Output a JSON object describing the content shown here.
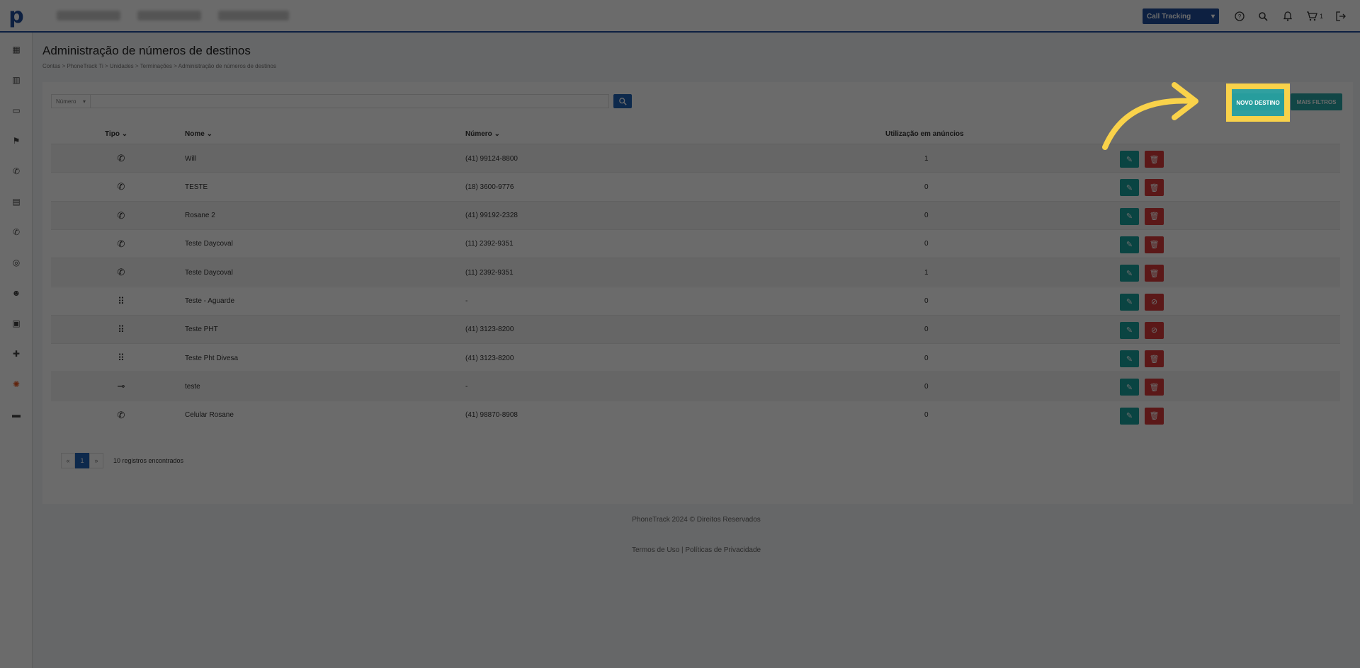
{
  "topbar": {
    "logo_letter": "p",
    "product_select": "Call Tracking",
    "cart_count": "1",
    "icons": [
      "help-icon",
      "search-icon",
      "bell-icon",
      "cart-icon",
      "logout-icon"
    ]
  },
  "sidebar": {
    "icons": [
      "dashboard-icon",
      "buildings-icon",
      "briefcase-icon",
      "flag-icon",
      "phone-icon",
      "contact-card-icon",
      "phone-in-icon",
      "circle-icon",
      "users-icon",
      "library-icon",
      "puzzle-icon",
      "settings-icon",
      "store-icon"
    ]
  },
  "page": {
    "title": "Administração de números de destinos",
    "breadcrumb": "Contas  >  PhoneTrack Ti  >  Unidades  >  Terminações  >  Administração de números de destinos"
  },
  "search": {
    "field_label": "Número",
    "placeholder": ""
  },
  "buttons": {
    "novo_destino": "NOVO DESTINO",
    "mais_filtros": "MAIS FILTROS"
  },
  "table": {
    "headers": {
      "tipo": "Tipo",
      "nome": "Nome",
      "numero": "Número",
      "utilizacao": "Utilização em anúncios"
    },
    "rows": [
      {
        "type_icon": "phone-icon",
        "nome": "Will",
        "numero": "(41) 99124-8800",
        "uso": "1",
        "second_action": "delete"
      },
      {
        "type_icon": "phone-icon",
        "nome": "TESTE",
        "numero": "(18) 3600-9776",
        "uso": "0",
        "second_action": "delete"
      },
      {
        "type_icon": "phone-icon",
        "nome": "Rosane 2",
        "numero": "(41) 99192-2328",
        "uso": "0",
        "second_action": "delete"
      },
      {
        "type_icon": "phone-icon",
        "nome": "Teste Daycoval",
        "numero": "(11) 2392-9351",
        "uso": "0",
        "second_action": "delete"
      },
      {
        "type_icon": "phone-icon",
        "nome": "Teste Daycoval",
        "numero": "(11) 2392-9351",
        "uso": "1",
        "second_action": "delete"
      },
      {
        "type_icon": "dialpad-icon",
        "nome": "Teste - Aguarde",
        "numero": "-",
        "uso": "0",
        "second_action": "block"
      },
      {
        "type_icon": "dialpad-icon",
        "nome": "Teste PHT",
        "numero": "(41) 3123-8200",
        "uso": "0",
        "second_action": "block"
      },
      {
        "type_icon": "dialpad-icon",
        "nome": "Teste Pht Divesa",
        "numero": "(41) 3123-8200",
        "uso": "0",
        "second_action": "delete"
      },
      {
        "type_icon": "voicemail-icon",
        "nome": "teste",
        "numero": "-",
        "uso": "0",
        "second_action": "delete"
      },
      {
        "type_icon": "phone-icon",
        "nome": "Celular Rosane",
        "numero": "(41) 98870-8908",
        "uso": "0",
        "second_action": "delete"
      }
    ]
  },
  "pagination": {
    "prev": "«",
    "current": "1",
    "next": "»",
    "records": "10 registros encontrados"
  },
  "footer": {
    "copyright": "PhoneTrack 2024 © Direitos Reservados",
    "links": "Termos de Uso | Políticas de Privacidade"
  },
  "colors": {
    "brand_blue": "#1f4e9c",
    "teal": "#2aa6a6",
    "danger": "#d83a3a",
    "highlight": "#f9d24a"
  }
}
